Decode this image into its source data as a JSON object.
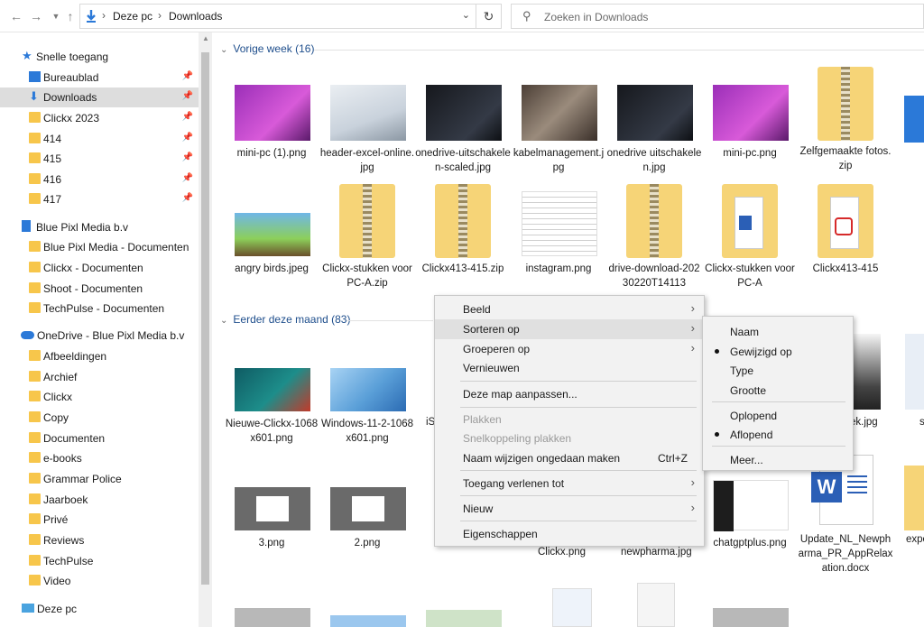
{
  "addressbar": {
    "crumbs": [
      "Deze pc",
      "Downloads"
    ],
    "search_placeholder": "Zoeken in Downloads"
  },
  "sidebar": {
    "quick_access": "Snelle toegang",
    "quick_items": [
      {
        "label": "Bureaublad"
      },
      {
        "label": "Downloads"
      },
      {
        "label": "Clickx 2023"
      },
      {
        "label": "414"
      },
      {
        "label": "415"
      },
      {
        "label": "416"
      },
      {
        "label": "417"
      }
    ],
    "bpm": "Blue Pixl Media b.v",
    "bpm_items": [
      "Blue Pixl Media - Documenten",
      "Clickx - Documenten",
      "Shoot - Documenten",
      "TechPulse - Documenten"
    ],
    "onedrive": "OneDrive - Blue Pixl Media b.v",
    "onedrive_items": [
      "Afbeeldingen",
      "Archief",
      "Clickx",
      "Copy",
      "Documenten",
      "e-books",
      "Grammar Police",
      "Jaarboek",
      "Privé",
      "Reviews",
      "TechPulse",
      "Video"
    ],
    "thispc": "Deze pc"
  },
  "groups": {
    "last_week": "Vorige week (16)",
    "this_month": "Eerder deze maand (83)"
  },
  "files_row1": [
    {
      "name": "mini-pc (1).png",
      "thumb": "purple"
    },
    {
      "name": "header-excel-online.jpg",
      "thumb": "magnifier"
    },
    {
      "name": "onedrive-uitschakelen-scaled.jpg",
      "thumb": "dark"
    },
    {
      "name": "kabelmanagement.jpg",
      "thumb": "desk"
    },
    {
      "name": "onedrive uitschakelen.jpg",
      "thumb": "dark"
    },
    {
      "name": "mini-pc.png",
      "thumb": "purple"
    },
    {
      "name": "Zelfgemaakte fotos.zip",
      "thumb": "zip"
    }
  ],
  "files_row2": [
    {
      "name": "angry birds.jpeg",
      "thumb": "birds"
    },
    {
      "name": "Clickx-stukken voor PC-A.zip",
      "thumb": "zip"
    },
    {
      "name": "Clickx413-415.zip",
      "thumb": "zip"
    },
    {
      "name": "instagram.png",
      "thumb": "doc"
    },
    {
      "name": "drive-download-20230220T14113",
      "thumb": "zip"
    },
    {
      "name": "Clickx-stukken voor PC-A",
      "thumb": "folderword"
    },
    {
      "name": "Clickx413-415",
      "thumb": "folderpdf"
    }
  ],
  "files_row3": [
    {
      "name": "Nieuwe-Clickx-1068x601.png",
      "thumb": "magazine"
    },
    {
      "name": "Windows-11-2-1068x601.png",
      "thumb": "win11"
    }
  ],
  "files_row4": [
    {
      "name": "3.png",
      "thumb": "screen"
    },
    {
      "name": "2.png",
      "thumb": "screen"
    }
  ],
  "files_row4_right": [
    {
      "name": "Clickx.png"
    },
    {
      "name": "newpharma.jpg"
    },
    {
      "name": "chatgptplus.png"
    },
    {
      "name": "Update_NL_Newpharma_PR_AppRelaxation.docx"
    },
    {
      "name": "expo"
    }
  ],
  "files_row3_partial": [
    "ek.jpg",
    "s",
    "iS"
  ],
  "context_menu": {
    "items": [
      {
        "label": "Beeld",
        "arrow": true
      },
      {
        "label": "Sorteren op",
        "arrow": true
      },
      {
        "label": "Groeperen op",
        "arrow": true
      },
      {
        "label": "Vernieuwen"
      },
      {
        "label": "Deze map aanpassen..."
      },
      {
        "label": "Plakken",
        "disabled": true
      },
      {
        "label": "Snelkoppeling plakken",
        "disabled": true
      },
      {
        "label": "Naam wijzigen ongedaan maken",
        "shortcut": "Ctrl+Z"
      },
      {
        "label": "Toegang verlenen tot",
        "arrow": true
      },
      {
        "label": "Nieuw",
        "arrow": true
      },
      {
        "label": "Eigenschappen"
      }
    ]
  },
  "sort_submenu": {
    "items": [
      "Naam",
      "Gewijzigd op",
      "Type",
      "Grootte",
      "Oplopend",
      "Aflopend",
      "Meer..."
    ],
    "selected": [
      "Gewijzigd op",
      "Aflopend"
    ]
  },
  "colors": {
    "accent": "#1e4e8c",
    "folder": "#f7c64b",
    "selection": "#dddddd"
  }
}
